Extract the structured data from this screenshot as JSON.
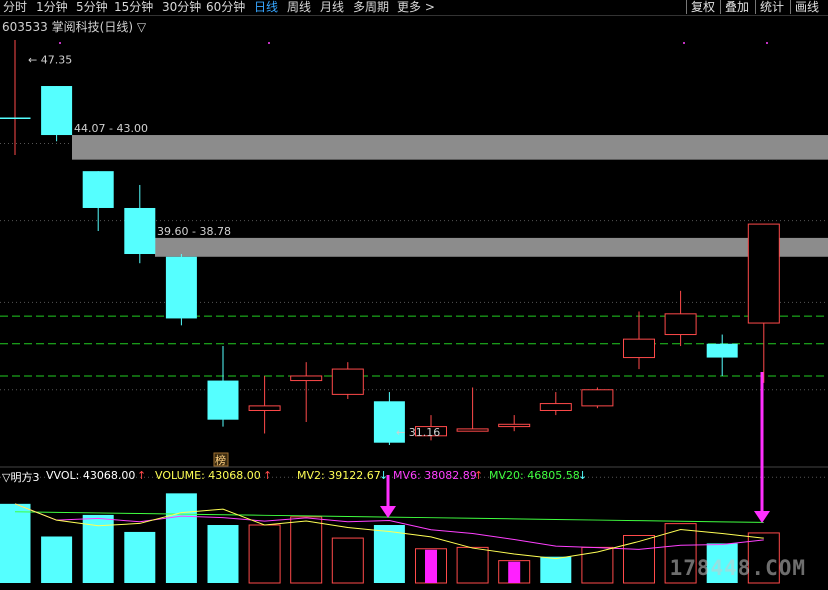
{
  "toolbar": {
    "periods": [
      "分时",
      "1分钟",
      "5分钟",
      "15分钟",
      "30分钟",
      "60分钟",
      "日线",
      "周线",
      "月线",
      "多周期",
      "更多 >"
    ],
    "active_period": "日线",
    "buttons": [
      "复权",
      "叠加",
      "统计",
      "画线"
    ]
  },
  "title": {
    "code": "603533",
    "name": "掌阅科技(日线)",
    "toggle": "▽"
  },
  "price_labels": {
    "high": "47.35",
    "low": "31.16"
  },
  "gaps": [
    {
      "label": "44.07 - 43.00",
      "top": 44.07,
      "bottom": 43.0
    },
    {
      "label": "39.60 - 38.78",
      "top": 39.6,
      "bottom": 38.78
    }
  ],
  "badge": "榜",
  "volume_panel": {
    "indicator": "▽明方3",
    "vvol_label": "VVOL: 43068.00",
    "volume_label": "VOLUME: 43068.00",
    "mv2_label": "MV2: 39122.67",
    "mv6_label": "MV6: 38082.89",
    "mv20_label": "MV20: 46805.58",
    "colors": {
      "vvol": "#ffffff",
      "volume": "#ffff55",
      "mv2": "#ffff55",
      "mv6": "#ff40ff",
      "mv20": "#40ff40",
      "up": "#ff4a4a",
      "down": "#55ffff"
    }
  },
  "watermark": "178448.COM",
  "chart_data": {
    "type": "candlestick",
    "price_range": [
      30.6,
      48.2
    ],
    "candles": [
      {
        "o": 44.8,
        "c": 44.8,
        "h": 48.2,
        "l": 43.2
      },
      {
        "o": 46.2,
        "c": 44.07,
        "h": 46.2,
        "l": 43.8
      },
      {
        "o": 42.5,
        "c": 40.9,
        "h": 42.5,
        "l": 39.9
      },
      {
        "o": 40.9,
        "c": 38.9,
        "h": 41.9,
        "l": 38.5
      },
      {
        "o": 38.78,
        "c": 36.1,
        "h": 38.9,
        "l": 35.8
      },
      {
        "o": 33.4,
        "c": 31.7,
        "h": 34.9,
        "l": 31.4
      },
      {
        "o": 32.1,
        "c": 32.3,
        "h": 33.6,
        "l": 31.1
      },
      {
        "o": 33.4,
        "c": 33.6,
        "h": 34.2,
        "l": 31.6
      },
      {
        "o": 32.8,
        "c": 33.9,
        "h": 34.2,
        "l": 32.6
      },
      {
        "o": 32.5,
        "c": 30.7,
        "h": 32.9,
        "l": 30.6
      },
      {
        "o": 31.0,
        "c": 31.4,
        "h": 31.9,
        "l": 30.8
      },
      {
        "o": 31.2,
        "c": 31.3,
        "h": 33.1,
        "l": 31.2
      },
      {
        "o": 31.4,
        "c": 31.5,
        "h": 31.9,
        "l": 31.2
      },
      {
        "o": 32.1,
        "c": 32.4,
        "h": 32.9,
        "l": 31.9
      },
      {
        "o": 32.3,
        "c": 33.0,
        "h": 33.1,
        "l": 32.2
      },
      {
        "o": 34.4,
        "c": 35.2,
        "h": 36.4,
        "l": 33.9
      },
      {
        "o": 35.4,
        "c": 36.3,
        "h": 37.3,
        "l": 34.9
      },
      {
        "o": 35.0,
        "c": 34.4,
        "h": 35.4,
        "l": 33.6
      },
      {
        "o": 35.9,
        "c": 40.2,
        "h": 40.2,
        "l": 33.3
      }
    ],
    "volumes": [
      {
        "v": 40000,
        "up": false
      },
      {
        "v": 23500,
        "up": false
      },
      {
        "v": 34400,
        "up": false
      },
      {
        "v": 25800,
        "up": false
      },
      {
        "v": 45300,
        "up": false
      },
      {
        "v": 29300,
        "up": false
      },
      {
        "v": 29300,
        "up": true
      },
      {
        "v": 33400,
        "up": true
      },
      {
        "v": 22700,
        "up": true
      },
      {
        "v": 29300,
        "up": false
      },
      {
        "v": 17300,
        "up": true,
        "fill": true
      },
      {
        "v": 18000,
        "up": true
      },
      {
        "v": 11300,
        "up": true,
        "fill": true
      },
      {
        "v": 13300,
        "up": false
      },
      {
        "v": 18000,
        "up": true
      },
      {
        "v": 24000,
        "up": true
      },
      {
        "v": 30000,
        "up": true
      },
      {
        "v": 20000,
        "up": false
      },
      {
        "v": 25300,
        "up": true
      }
    ],
    "volume_max": 48000,
    "h_lines": [
      {
        "price": 36.2,
        "style": "dash-green"
      },
      {
        "price": 35.0,
        "style": "dash-green"
      },
      {
        "price": 33.6,
        "style": "dash-green"
      }
    ],
    "dotted_prices": [
      43.7,
      40.35,
      36.8,
      33.0,
      29.2
    ]
  }
}
